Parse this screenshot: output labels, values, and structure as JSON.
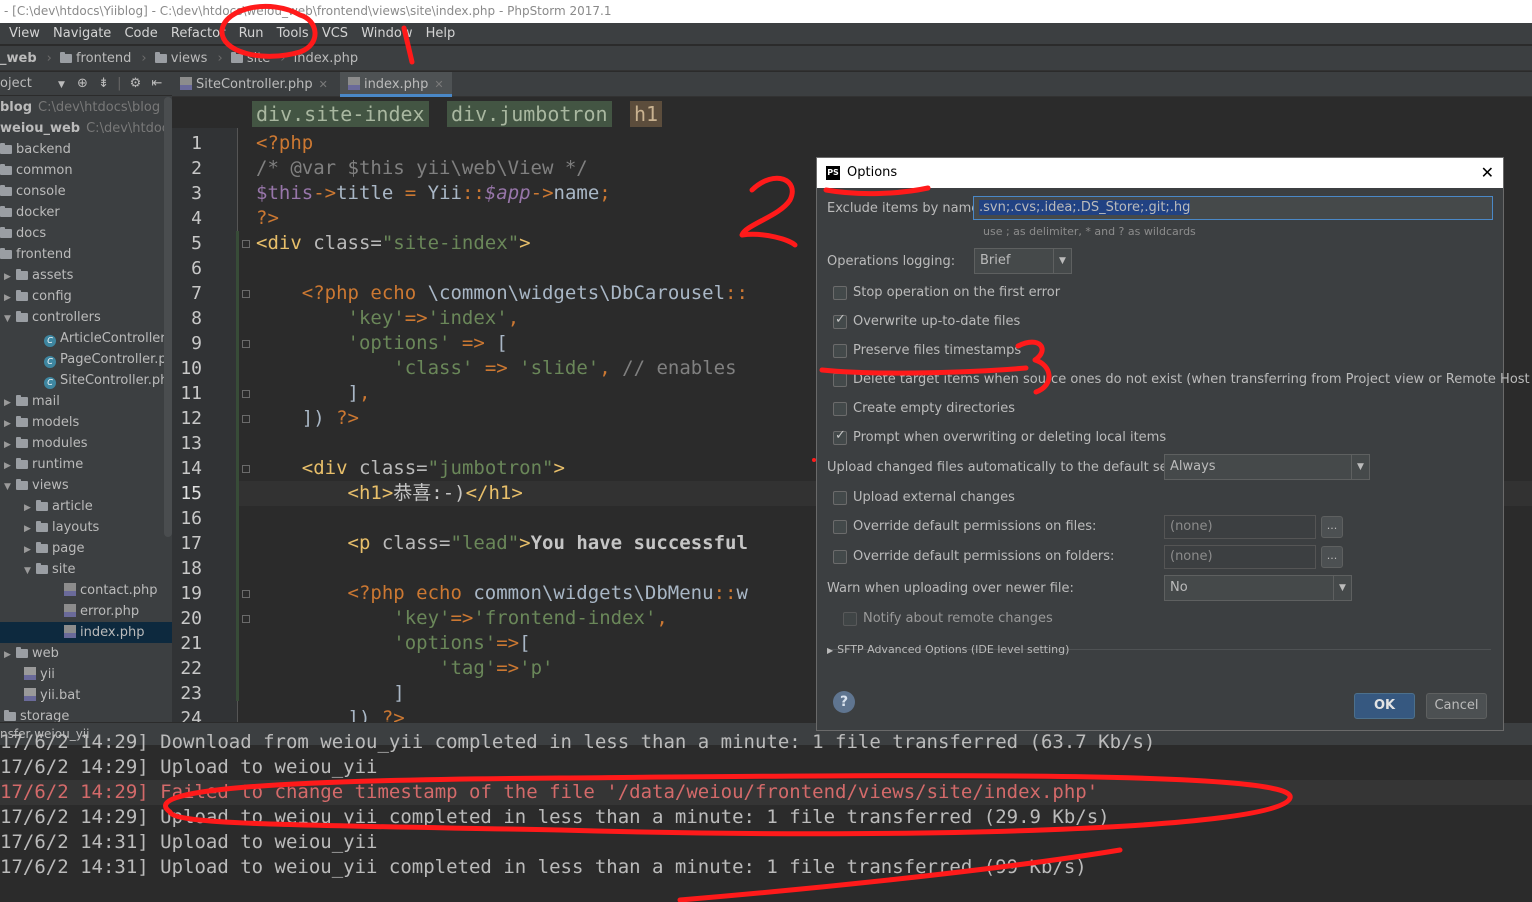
{
  "window": {
    "title": "- [C:\\dev\\htdocs\\Yiiblog] - C:\\dev\\htdocs\\weiou_web\\frontend\\views\\site\\index.php - PhpStorm 2017.1"
  },
  "menu": [
    "View",
    "Navigate",
    "Code",
    "Refactor",
    "Run",
    "Tools",
    "VCS",
    "Window",
    "Help"
  ],
  "nav": {
    "items": [
      "_web",
      "frontend",
      "views",
      "site",
      "index.php"
    ]
  },
  "sidebar": {
    "header": "oject",
    "items": [
      {
        "label": "blog",
        "dim": "C:\\dev\\htdocs\\blog",
        "type": "root"
      },
      {
        "label": "weiou_web",
        "dim": "C:\\dev\\htdocs\\w",
        "type": "root"
      },
      {
        "label": "backend",
        "type": "folder"
      },
      {
        "label": "common",
        "type": "folder"
      },
      {
        "label": "console",
        "type": "folder"
      },
      {
        "label": "docker",
        "type": "folder"
      },
      {
        "label": "docs",
        "type": "folder"
      },
      {
        "label": "frontend",
        "type": "folder"
      },
      {
        "label": "assets",
        "type": "folder",
        "arrow": "▶"
      },
      {
        "label": "config",
        "type": "folder",
        "arrow": "▶"
      },
      {
        "label": "controllers",
        "type": "folder",
        "arrow": "▼"
      },
      {
        "label": "ArticleController.ph",
        "type": "class"
      },
      {
        "label": "PageController.php",
        "type": "class"
      },
      {
        "label": "SiteController.php",
        "type": "class"
      },
      {
        "label": "mail",
        "type": "folder",
        "arrow": "▶"
      },
      {
        "label": "models",
        "type": "folder",
        "arrow": "▶"
      },
      {
        "label": "modules",
        "type": "folder",
        "arrow": "▶"
      },
      {
        "label": "runtime",
        "type": "folder",
        "arrow": "▶"
      },
      {
        "label": "views",
        "type": "folder",
        "arrow": "▼"
      },
      {
        "label": "article",
        "type": "folder",
        "arrow": "▶"
      },
      {
        "label": "layouts",
        "type": "folder",
        "arrow": "▶"
      },
      {
        "label": "page",
        "type": "folder",
        "arrow": "▶"
      },
      {
        "label": "site",
        "type": "folder",
        "arrow": "▼"
      },
      {
        "label": "contact.php",
        "type": "php"
      },
      {
        "label": "error.php",
        "type": "php"
      },
      {
        "label": "index.php",
        "type": "php",
        "selected": true
      },
      {
        "label": "web",
        "type": "folder",
        "arrow": "▶"
      },
      {
        "label": "yii",
        "type": "file"
      },
      {
        "label": "yii.bat",
        "type": "file"
      },
      {
        "label": "storage",
        "type": "folder"
      }
    ]
  },
  "tabs": [
    {
      "label": "SiteController.php",
      "active": false
    },
    {
      "label": "index.php",
      "active": true
    }
  ],
  "breadcrumb": [
    "div.site-index",
    "div.jumbotron",
    "h1"
  ],
  "editor": {
    "line_numbers": [
      "1",
      "2",
      "3",
      "4",
      "5",
      "6",
      "7",
      "8",
      "9",
      "10",
      "11",
      "12",
      "13",
      "14",
      "15",
      "16",
      "17",
      "18",
      "19",
      "20",
      "21",
      "22",
      "23",
      "24"
    ],
    "current_line": 15
  },
  "bottom": {
    "title": "nsfer weiou_yii"
  },
  "console": [
    {
      "text": "17/6/2 14:29] Download from weiou_yii completed in less than a minute: 1 file transferred (63.7 Kb/s)",
      "error": false
    },
    {
      "text": "17/6/2 14:29] Upload to weiou_yii",
      "error": false
    },
    {
      "prefix": "17/6/2 14:29] ",
      "text": "Failed to change timestamp of the file '/data/weiou/frontend/views/site/index.php'",
      "error": true
    },
    {
      "text": "17/6/2 14:29] Upload to weiou_yii completed in less than a minute: 1 file transferred (29.9 Kb/s)",
      "error": false
    },
    {
      "text": "17/6/2 14:31] Upload to weiou_yii",
      "error": false
    },
    {
      "text": "17/6/2 14:31] Upload to weiou_yii completed in less than a minute: 1 file transferred (99 Kb/s)",
      "error": false
    }
  ],
  "dialog": {
    "title": "Options",
    "exclude_label": "Exclude items by name:",
    "exclude_value": ".svn;.cvs;.idea;.DS_Store;.git;.hg",
    "exclude_hint": "use ; as delimiter, * and ? as wildcards",
    "logging_label": "Operations logging:",
    "logging_value": "Brief",
    "checkboxes": [
      {
        "label": "Stop operation on the first error",
        "checked": false
      },
      {
        "label": "Overwrite up-to-date files",
        "checked": true
      },
      {
        "label": "Preserve files timestamps",
        "checked": false
      },
      {
        "label": "Delete target items when source ones do not exist (when transferring from Project view or Remote Host view)",
        "checked": false
      },
      {
        "label": "Create empty directories",
        "checked": false
      },
      {
        "label": "Prompt when overwriting or deleting local items",
        "checked": true
      }
    ],
    "upload_auto_label": "Upload changed files automatically to the default server",
    "upload_auto_value": "Always",
    "upload_external_label": "Upload external changes",
    "override_files_label": "Override default permissions on files:",
    "override_files_value": "(none)",
    "override_folders_label": "Override default permissions on folders:",
    "override_folders_value": "(none)",
    "warn_label": "Warn when uploading over newer file:",
    "warn_value": "No",
    "notify_label": "Notify about remote changes",
    "sftp_label": "SFTP Advanced Options (IDE level setting)",
    "ok_label": "OK",
    "cancel_label": "Cancel",
    "help_label": "?",
    "dots_label": "..."
  },
  "annotations": [
    "1",
    "2",
    "3"
  ],
  "colors": {
    "accent": "#4a88c7",
    "annotation": "#ff1a1a",
    "error": "#d46a6a"
  }
}
